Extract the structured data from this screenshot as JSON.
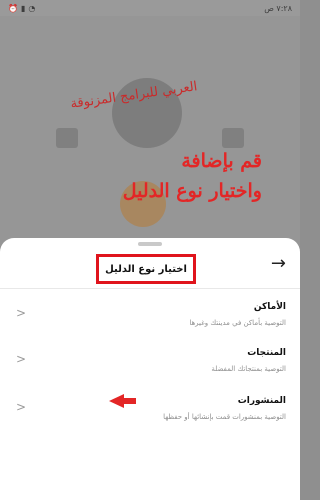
{
  "status": {
    "time": "٧:٢٨ ص"
  },
  "watermark": "العربي للبرامج المزنوقة",
  "annotation": {
    "line1": "قم بإضافة",
    "line2": "واختيار نوع الدليل"
  },
  "sheet": {
    "title": "اختيار نوع الدليل",
    "options": [
      {
        "title": "الأماكن",
        "desc": "التوصية بأماكن في مدينتك وغيرها"
      },
      {
        "title": "المنتجات",
        "desc": "التوصية بمنتجاتك المفضلة"
      },
      {
        "title": "المنشورات",
        "desc": "التوصية بمنشورات قمت بإنشائها أو حفظها"
      }
    ]
  },
  "colors": {
    "highlight": "#e0141c",
    "annotation": "#e32626"
  },
  "icons": {
    "back": "arrow-right-icon",
    "chevron": "chevron-left-icon"
  }
}
